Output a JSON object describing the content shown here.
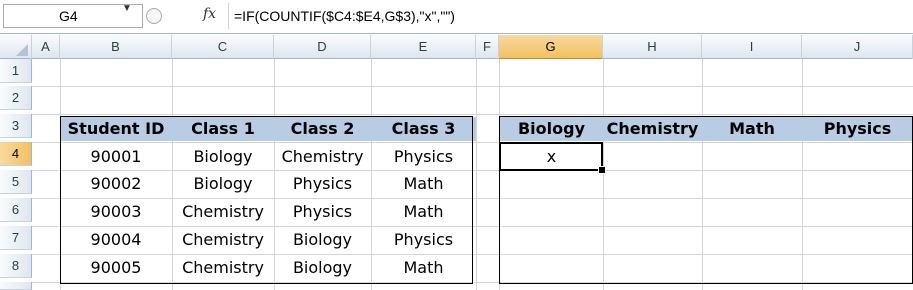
{
  "formula_bar": {
    "name_box": "G4",
    "fx_label": "fx",
    "formula": "=IF(COUNTIF($C4:$E4,G$3),\"x\",\"\")"
  },
  "columns": [
    "A",
    "B",
    "C",
    "D",
    "E",
    "F",
    "G",
    "H",
    "I",
    "J"
  ],
  "rows": [
    "1",
    "2",
    "3",
    "4",
    "5",
    "6",
    "7",
    "8"
  ],
  "table1": {
    "headers": [
      "Student ID",
      "Class 1",
      "Class 2",
      "Class 3"
    ],
    "rows": [
      [
        "90001",
        "Biology",
        "Chemistry",
        "Physics"
      ],
      [
        "90002",
        "Biology",
        "Physics",
        "Math"
      ],
      [
        "90003",
        "Chemistry",
        "Physics",
        "Math"
      ],
      [
        "90004",
        "Chemistry",
        "Biology",
        "Physics"
      ],
      [
        "90005",
        "Chemistry",
        "Biology",
        "Math"
      ]
    ]
  },
  "table2": {
    "headers": [
      "Biology",
      "Chemistry",
      "Math",
      "Physics"
    ],
    "rows": [
      [
        "x",
        "",
        "",
        ""
      ],
      [
        "",
        "",
        "",
        ""
      ],
      [
        "",
        "",
        "",
        ""
      ],
      [
        "",
        "",
        "",
        ""
      ],
      [
        "",
        "",
        "",
        ""
      ]
    ]
  },
  "selection": {
    "cell": "G4",
    "column": "G",
    "row": "4"
  },
  "colors": {
    "header_fill": "#b8cce4",
    "selection_header": "#f1c15f"
  }
}
